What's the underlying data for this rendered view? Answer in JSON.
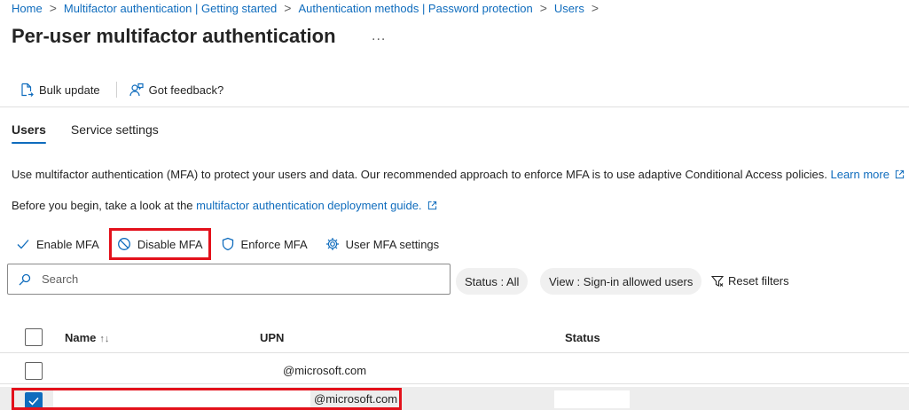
{
  "breadcrumb": {
    "items": [
      "Home",
      "Multifactor authentication | Getting started",
      "Authentication methods | Password protection",
      "Users"
    ],
    "separator": ">"
  },
  "page": {
    "title": "Per-user multifactor authentication",
    "more": "..."
  },
  "commands": {
    "bulk_update": "Bulk update",
    "feedback": "Got feedback?"
  },
  "tabs": [
    {
      "label": "Users",
      "active": true
    },
    {
      "label": "Service settings",
      "active": false
    }
  ],
  "info": {
    "line1": "Use multifactor authentication (MFA) to protect your users and data. Our recommended approach to enforce MFA is to use adaptive Conditional Access policies.",
    "learn_more": "Learn more",
    "line2_prefix": "Before you begin, take a look at the",
    "guide_link": "multifactor authentication deployment guide."
  },
  "actions": {
    "enable": "Enable MFA",
    "disable": "Disable MFA",
    "enforce": "Enforce MFA",
    "settings": "User MFA settings"
  },
  "search": {
    "placeholder": "Search",
    "value": ""
  },
  "filters": {
    "status": "Status : All",
    "view": "View : Sign-in allowed users",
    "reset": "Reset filters"
  },
  "table": {
    "columns": {
      "name": "Name",
      "upn": "UPN",
      "status": "Status"
    },
    "sort_glyph": "↑↓",
    "rows": [
      {
        "name": "",
        "upn": "@microsoft.com",
        "status": "",
        "checked": false
      },
      {
        "name": "",
        "upn": "@microsoft.com",
        "status": "",
        "checked": true
      }
    ]
  },
  "colors": {
    "accent": "#0f6cbd",
    "highlight": "#e3111b"
  }
}
